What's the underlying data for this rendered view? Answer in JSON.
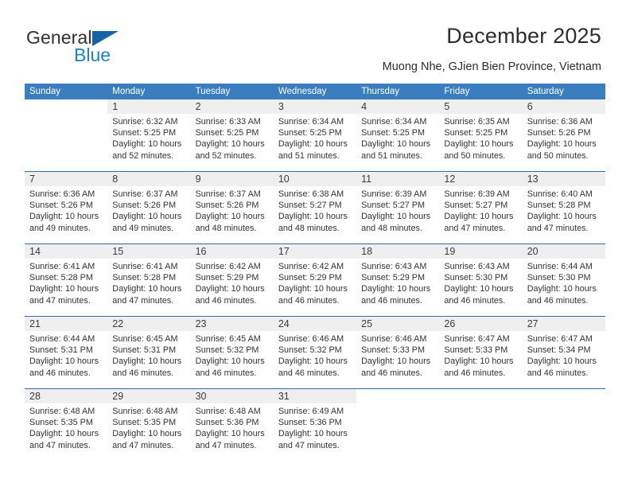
{
  "brand": {
    "name_top": "General",
    "name_bottom": "Blue",
    "accent_color": "#1f7fc4",
    "triangle_color": "#1464a5"
  },
  "header": {
    "title": "December 2025",
    "subtitle": "Muong Nhe, GJien Bien Province, Vietnam",
    "header_bg": "#3a7ebf",
    "row_separator_color": "#2b6ca3",
    "daynum_band_color": "#efefef"
  },
  "weekday_headers": [
    "Sunday",
    "Monday",
    "Tuesday",
    "Wednesday",
    "Thursday",
    "Friday",
    "Saturday"
  ],
  "labels": {
    "sunrise_prefix": "Sunrise:",
    "sunset_prefix": "Sunset:",
    "daylight_prefix": "Daylight:"
  },
  "weeks": [
    [
      {
        "day": "",
        "empty": true,
        "lines": []
      },
      {
        "day": "1",
        "lines": [
          "Sunrise: 6:32 AM",
          "Sunset: 5:25 PM",
          "Daylight: 10 hours",
          "and 52 minutes."
        ]
      },
      {
        "day": "2",
        "lines": [
          "Sunrise: 6:33 AM",
          "Sunset: 5:25 PM",
          "Daylight: 10 hours",
          "and 52 minutes."
        ]
      },
      {
        "day": "3",
        "lines": [
          "Sunrise: 6:34 AM",
          "Sunset: 5:25 PM",
          "Daylight: 10 hours",
          "and 51 minutes."
        ]
      },
      {
        "day": "4",
        "lines": [
          "Sunrise: 6:34 AM",
          "Sunset: 5:25 PM",
          "Daylight: 10 hours",
          "and 51 minutes."
        ]
      },
      {
        "day": "5",
        "lines": [
          "Sunrise: 6:35 AM",
          "Sunset: 5:25 PM",
          "Daylight: 10 hours",
          "and 50 minutes."
        ]
      },
      {
        "day": "6",
        "lines": [
          "Sunrise: 6:36 AM",
          "Sunset: 5:26 PM",
          "Daylight: 10 hours",
          "and 50 minutes."
        ]
      }
    ],
    [
      {
        "day": "7",
        "lines": [
          "Sunrise: 6:36 AM",
          "Sunset: 5:26 PM",
          "Daylight: 10 hours",
          "and 49 minutes."
        ]
      },
      {
        "day": "8",
        "lines": [
          "Sunrise: 6:37 AM",
          "Sunset: 5:26 PM",
          "Daylight: 10 hours",
          "and 49 minutes."
        ]
      },
      {
        "day": "9",
        "lines": [
          "Sunrise: 6:37 AM",
          "Sunset: 5:26 PM",
          "Daylight: 10 hours",
          "and 48 minutes."
        ]
      },
      {
        "day": "10",
        "lines": [
          "Sunrise: 6:38 AM",
          "Sunset: 5:27 PM",
          "Daylight: 10 hours",
          "and 48 minutes."
        ]
      },
      {
        "day": "11",
        "lines": [
          "Sunrise: 6:39 AM",
          "Sunset: 5:27 PM",
          "Daylight: 10 hours",
          "and 48 minutes."
        ]
      },
      {
        "day": "12",
        "lines": [
          "Sunrise: 6:39 AM",
          "Sunset: 5:27 PM",
          "Daylight: 10 hours",
          "and 47 minutes."
        ]
      },
      {
        "day": "13",
        "lines": [
          "Sunrise: 6:40 AM",
          "Sunset: 5:28 PM",
          "Daylight: 10 hours",
          "and 47 minutes."
        ]
      }
    ],
    [
      {
        "day": "14",
        "lines": [
          "Sunrise: 6:41 AM",
          "Sunset: 5:28 PM",
          "Daylight: 10 hours",
          "and 47 minutes."
        ]
      },
      {
        "day": "15",
        "lines": [
          "Sunrise: 6:41 AM",
          "Sunset: 5:28 PM",
          "Daylight: 10 hours",
          "and 47 minutes."
        ]
      },
      {
        "day": "16",
        "lines": [
          "Sunrise: 6:42 AM",
          "Sunset: 5:29 PM",
          "Daylight: 10 hours",
          "and 46 minutes."
        ]
      },
      {
        "day": "17",
        "lines": [
          "Sunrise: 6:42 AM",
          "Sunset: 5:29 PM",
          "Daylight: 10 hours",
          "and 46 minutes."
        ]
      },
      {
        "day": "18",
        "lines": [
          "Sunrise: 6:43 AM",
          "Sunset: 5:29 PM",
          "Daylight: 10 hours",
          "and 46 minutes."
        ]
      },
      {
        "day": "19",
        "lines": [
          "Sunrise: 6:43 AM",
          "Sunset: 5:30 PM",
          "Daylight: 10 hours",
          "and 46 minutes."
        ]
      },
      {
        "day": "20",
        "lines": [
          "Sunrise: 6:44 AM",
          "Sunset: 5:30 PM",
          "Daylight: 10 hours",
          "and 46 minutes."
        ]
      }
    ],
    [
      {
        "day": "21",
        "lines": [
          "Sunrise: 6:44 AM",
          "Sunset: 5:31 PM",
          "Daylight: 10 hours",
          "and 46 minutes."
        ]
      },
      {
        "day": "22",
        "lines": [
          "Sunrise: 6:45 AM",
          "Sunset: 5:31 PM",
          "Daylight: 10 hours",
          "and 46 minutes."
        ]
      },
      {
        "day": "23",
        "lines": [
          "Sunrise: 6:45 AM",
          "Sunset: 5:32 PM",
          "Daylight: 10 hours",
          "and 46 minutes."
        ]
      },
      {
        "day": "24",
        "lines": [
          "Sunrise: 6:46 AM",
          "Sunset: 5:32 PM",
          "Daylight: 10 hours",
          "and 46 minutes."
        ]
      },
      {
        "day": "25",
        "lines": [
          "Sunrise: 6:46 AM",
          "Sunset: 5:33 PM",
          "Daylight: 10 hours",
          "and 46 minutes."
        ]
      },
      {
        "day": "26",
        "lines": [
          "Sunrise: 6:47 AM",
          "Sunset: 5:33 PM",
          "Daylight: 10 hours",
          "and 46 minutes."
        ]
      },
      {
        "day": "27",
        "lines": [
          "Sunrise: 6:47 AM",
          "Sunset: 5:34 PM",
          "Daylight: 10 hours",
          "and 46 minutes."
        ]
      }
    ],
    [
      {
        "day": "28",
        "lines": [
          "Sunrise: 6:48 AM",
          "Sunset: 5:35 PM",
          "Daylight: 10 hours",
          "and 47 minutes."
        ]
      },
      {
        "day": "29",
        "lines": [
          "Sunrise: 6:48 AM",
          "Sunset: 5:35 PM",
          "Daylight: 10 hours",
          "and 47 minutes."
        ]
      },
      {
        "day": "30",
        "lines": [
          "Sunrise: 6:48 AM",
          "Sunset: 5:36 PM",
          "Daylight: 10 hours",
          "and 47 minutes."
        ]
      },
      {
        "day": "31",
        "lines": [
          "Sunrise: 6:49 AM",
          "Sunset: 5:36 PM",
          "Daylight: 10 hours",
          "and 47 minutes."
        ]
      },
      {
        "day": "",
        "empty": true,
        "lines": []
      },
      {
        "day": "",
        "empty": true,
        "lines": []
      },
      {
        "day": "",
        "empty": true,
        "lines": []
      }
    ]
  ]
}
